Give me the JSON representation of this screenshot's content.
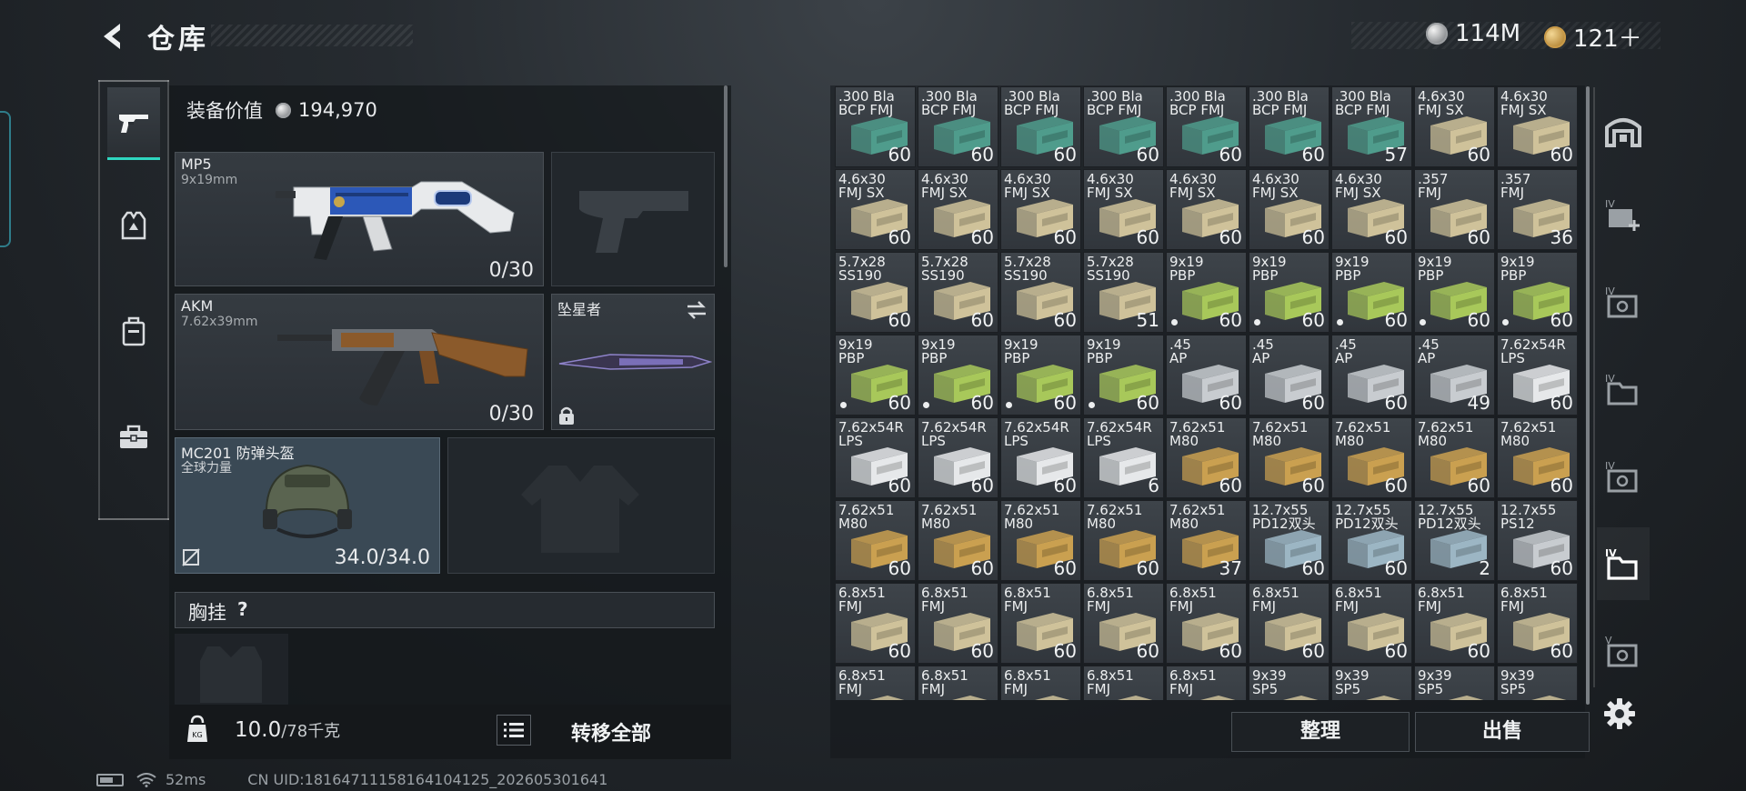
{
  "header": {
    "title": "仓库",
    "currency_silver": "114M",
    "currency_gold": "121＋"
  },
  "equipment": {
    "value_label": "装备价值",
    "value": "194,970",
    "primary": {
      "name": "MP5",
      "caliber": "9x19mm",
      "ammo": "0/30"
    },
    "secondary": {
      "name": "AKM",
      "caliber": "7.62x39mm",
      "ammo": "0/30"
    },
    "melee": {
      "name": "坠星者"
    },
    "helmet": {
      "name": "MC201 防弹头盔",
      "brand": "全球力量",
      "durability": "34.0/34.0"
    },
    "chest_rig": {
      "label": "胸挂",
      "help": "?"
    }
  },
  "footer": {
    "weight": "10.0",
    "weight_max": "/78千克",
    "transfer_all": "转移全部",
    "organize": "整理",
    "sell": "出售"
  },
  "status": {
    "ping": "52ms",
    "uid": "CN UID:18164711158164104125_202605301641"
  },
  "icons": {
    "back": "back-arrow-icon",
    "silver": "silver-coin-icon",
    "gold": "gold-coin-icon",
    "settings": "gear-icon"
  },
  "colors": {
    "accent": "#2fd6c0",
    "box_teal": "#4f9c8c",
    "box_tan": "#cfc29a",
    "box_green": "#a8c85a",
    "box_silver": "#c8ccd0",
    "box_white": "#e6e8ea",
    "box_gold": "#caa050",
    "box_blue": "#9cb6c4"
  },
  "storage": [
    [
      {
        "l1": ".300 Bla",
        "l2": "BCP FMJ",
        "count": "60",
        "box": "teal"
      },
      {
        "l1": ".300 Bla",
        "l2": "BCP FMJ",
        "count": "60",
        "box": "teal"
      },
      {
        "l1": ".300 Bla",
        "l2": "BCP FMJ",
        "count": "60",
        "box": "teal"
      },
      {
        "l1": ".300 Bla",
        "l2": "BCP FMJ",
        "count": "60",
        "box": "teal"
      },
      {
        "l1": ".300 Bla",
        "l2": "BCP FMJ",
        "count": "60",
        "box": "teal"
      },
      {
        "l1": ".300 Bla",
        "l2": "BCP FMJ",
        "count": "60",
        "box": "teal"
      },
      {
        "l1": ".300 Bla",
        "l2": "BCP FMJ",
        "count": "57",
        "box": "teal"
      },
      {
        "l1": "4.6x30",
        "l2": "FMJ SX",
        "count": "60",
        "box": "tan"
      },
      {
        "l1": "4.6x30",
        "l2": "FMJ SX",
        "count": "60",
        "box": "tan"
      }
    ],
    [
      {
        "l1": "4.6x30",
        "l2": "FMJ SX",
        "count": "60",
        "box": "tan"
      },
      {
        "l1": "4.6x30",
        "l2": "FMJ SX",
        "count": "60",
        "box": "tan"
      },
      {
        "l1": "4.6x30",
        "l2": "FMJ SX",
        "count": "60",
        "box": "tan"
      },
      {
        "l1": "4.6x30",
        "l2": "FMJ SX",
        "count": "60",
        "box": "tan"
      },
      {
        "l1": "4.6x30",
        "l2": "FMJ SX",
        "count": "60",
        "box": "tan"
      },
      {
        "l1": "4.6x30",
        "l2": "FMJ SX",
        "count": "60",
        "box": "tan"
      },
      {
        "l1": "4.6x30",
        "l2": "FMJ SX",
        "count": "60",
        "box": "tan"
      },
      {
        "l1": ".357",
        "l2": "FMJ",
        "count": "60",
        "box": "tan"
      },
      {
        "l1": ".357",
        "l2": "FMJ",
        "count": "36",
        "box": "tan"
      }
    ],
    [
      {
        "l1": "5.7x28",
        "l2": "SS190",
        "count": "60",
        "box": "tan"
      },
      {
        "l1": "5.7x28",
        "l2": "SS190",
        "count": "60",
        "box": "tan"
      },
      {
        "l1": "5.7x28",
        "l2": "SS190",
        "count": "60",
        "box": "tan"
      },
      {
        "l1": "5.7x28",
        "l2": "SS190",
        "count": "51",
        "box": "tan"
      },
      {
        "l1": "9x19",
        "l2": "PBP",
        "count": "60",
        "box": "green",
        "dot": true
      },
      {
        "l1": "9x19",
        "l2": "PBP",
        "count": "60",
        "box": "green",
        "dot": true
      },
      {
        "l1": "9x19",
        "l2": "PBP",
        "count": "60",
        "box": "green",
        "dot": true
      },
      {
        "l1": "9x19",
        "l2": "PBP",
        "count": "60",
        "box": "green",
        "dot": true
      },
      {
        "l1": "9x19",
        "l2": "PBP",
        "count": "60",
        "box": "green",
        "dot": true
      }
    ],
    [
      {
        "l1": "9x19",
        "l2": "PBP",
        "count": "60",
        "box": "green",
        "dot": true
      },
      {
        "l1": "9x19",
        "l2": "PBP",
        "count": "60",
        "box": "green",
        "dot": true
      },
      {
        "l1": "9x19",
        "l2": "PBP",
        "count": "60",
        "box": "green",
        "dot": true
      },
      {
        "l1": "9x19",
        "l2": "PBP",
        "count": "60",
        "box": "green",
        "dot": true
      },
      {
        "l1": ".45",
        "l2": "AP",
        "count": "60",
        "box": "silver"
      },
      {
        "l1": ".45",
        "l2": "AP",
        "count": "60",
        "box": "silver"
      },
      {
        "l1": ".45",
        "l2": "AP",
        "count": "60",
        "box": "silver"
      },
      {
        "l1": ".45",
        "l2": "AP",
        "count": "49",
        "box": "silver"
      },
      {
        "l1": "7.62x54R",
        "l2": "LPS",
        "count": "60",
        "box": "white"
      }
    ],
    [
      {
        "l1": "7.62x54R",
        "l2": "LPS",
        "count": "60",
        "box": "white"
      },
      {
        "l1": "7.62x54R",
        "l2": "LPS",
        "count": "60",
        "box": "white"
      },
      {
        "l1": "7.62x54R",
        "l2": "LPS",
        "count": "60",
        "box": "white"
      },
      {
        "l1": "7.62x54R",
        "l2": "LPS",
        "count": "6",
        "box": "white"
      },
      {
        "l1": "7.62x51",
        "l2": "M80",
        "count": "60",
        "box": "gold"
      },
      {
        "l1": "7.62x51",
        "l2": "M80",
        "count": "60",
        "box": "gold"
      },
      {
        "l1": "7.62x51",
        "l2": "M80",
        "count": "60",
        "box": "gold"
      },
      {
        "l1": "7.62x51",
        "l2": "M80",
        "count": "60",
        "box": "gold"
      },
      {
        "l1": "7.62x51",
        "l2": "M80",
        "count": "60",
        "box": "gold"
      }
    ],
    [
      {
        "l1": "7.62x51",
        "l2": "M80",
        "count": "60",
        "box": "gold"
      },
      {
        "l1": "7.62x51",
        "l2": "M80",
        "count": "60",
        "box": "gold"
      },
      {
        "l1": "7.62x51",
        "l2": "M80",
        "count": "60",
        "box": "gold"
      },
      {
        "l1": "7.62x51",
        "l2": "M80",
        "count": "60",
        "box": "gold"
      },
      {
        "l1": "7.62x51",
        "l2": "M80",
        "count": "37",
        "box": "gold"
      },
      {
        "l1": "12.7x55",
        "l2": "PD12双头",
        "count": "60",
        "box": "blue"
      },
      {
        "l1": "12.7x55",
        "l2": "PD12双头",
        "count": "60",
        "box": "blue"
      },
      {
        "l1": "12.7x55",
        "l2": "PD12双头",
        "count": "2",
        "box": "blue"
      },
      {
        "l1": "12.7x55",
        "l2": "PS12",
        "count": "60",
        "box": "silver"
      }
    ],
    [
      {
        "l1": "6.8x51",
        "l2": "FMJ",
        "count": "60",
        "box": "tan"
      },
      {
        "l1": "6.8x51",
        "l2": "FMJ",
        "count": "60",
        "box": "tan"
      },
      {
        "l1": "6.8x51",
        "l2": "FMJ",
        "count": "60",
        "box": "tan"
      },
      {
        "l1": "6.8x51",
        "l2": "FMJ",
        "count": "60",
        "box": "tan"
      },
      {
        "l1": "6.8x51",
        "l2": "FMJ",
        "count": "60",
        "box": "tan"
      },
      {
        "l1": "6.8x51",
        "l2": "FMJ",
        "count": "60",
        "box": "tan"
      },
      {
        "l1": "6.8x51",
        "l2": "FMJ",
        "count": "60",
        "box": "tan"
      },
      {
        "l1": "6.8x51",
        "l2": "FMJ",
        "count": "60",
        "box": "tan"
      },
      {
        "l1": "6.8x51",
        "l2": "FMJ",
        "count": "60",
        "box": "tan"
      }
    ],
    [
      {
        "l1": "6.8x51",
        "l2": "FMJ",
        "count": "",
        "box": "tan"
      },
      {
        "l1": "6.8x51",
        "l2": "FMJ",
        "count": "",
        "box": "tan"
      },
      {
        "l1": "6.8x51",
        "l2": "FMJ",
        "count": "",
        "box": "tan"
      },
      {
        "l1": "6.8x51",
        "l2": "FMJ",
        "count": "",
        "box": "tan"
      },
      {
        "l1": "6.8x51",
        "l2": "FMJ",
        "count": "",
        "box": "tan"
      },
      {
        "l1": "9x39",
        "l2": "SP5",
        "count": "",
        "box": "tan"
      },
      {
        "l1": "9x39",
        "l2": "SP5",
        "count": "",
        "box": "tan"
      },
      {
        "l1": "9x39",
        "l2": "SP5",
        "count": "",
        "box": "tan"
      },
      {
        "l1": "9x39",
        "l2": "SP5",
        "count": "",
        "box": "tan"
      }
    ]
  ]
}
